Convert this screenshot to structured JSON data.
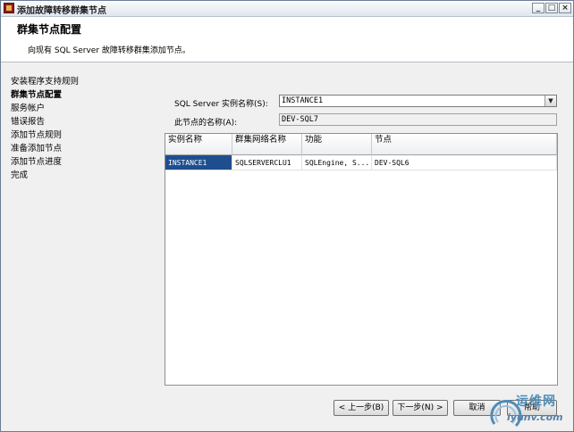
{
  "window": {
    "title": "添加故障转移群集节点"
  },
  "header": {
    "title": "群集节点配置",
    "subtitle": "向现有 SQL Server 故障转移群集添加节点。"
  },
  "sidebar": {
    "items": [
      {
        "label": "安装程序支持规则",
        "active": false
      },
      {
        "label": "群集节点配置",
        "active": true
      },
      {
        "label": "服务帐户",
        "active": false
      },
      {
        "label": "错误报告",
        "active": false
      },
      {
        "label": "添加节点规则",
        "active": false
      },
      {
        "label": "准备添加节点",
        "active": false
      },
      {
        "label": "添加节点进度",
        "active": false
      },
      {
        "label": "完成",
        "active": false
      }
    ]
  },
  "form": {
    "instance_label": "SQL Server 实例名称(S):",
    "instance_value": "INSTANCE1",
    "node_label": "此节点的名称(A):",
    "node_value": "DEV-SQL7"
  },
  "table": {
    "headers": [
      "实例名称",
      "群集网络名称",
      "功能",
      "节点"
    ],
    "rows": [
      [
        "INSTANCE1",
        "SQLSERVERCLU1",
        "SQLEngine, S...",
        "DEV-SQL6"
      ]
    ]
  },
  "buttons": {
    "back": "< 上一步(B)",
    "next": "下一步(N) >",
    "cancel": "取消",
    "help": "帮助"
  },
  "watermark": {
    "text": "运维网",
    "url": "iyunv.com"
  },
  "colors": {
    "selection": "#1f4e8f",
    "watermark": "#4f8db8"
  }
}
